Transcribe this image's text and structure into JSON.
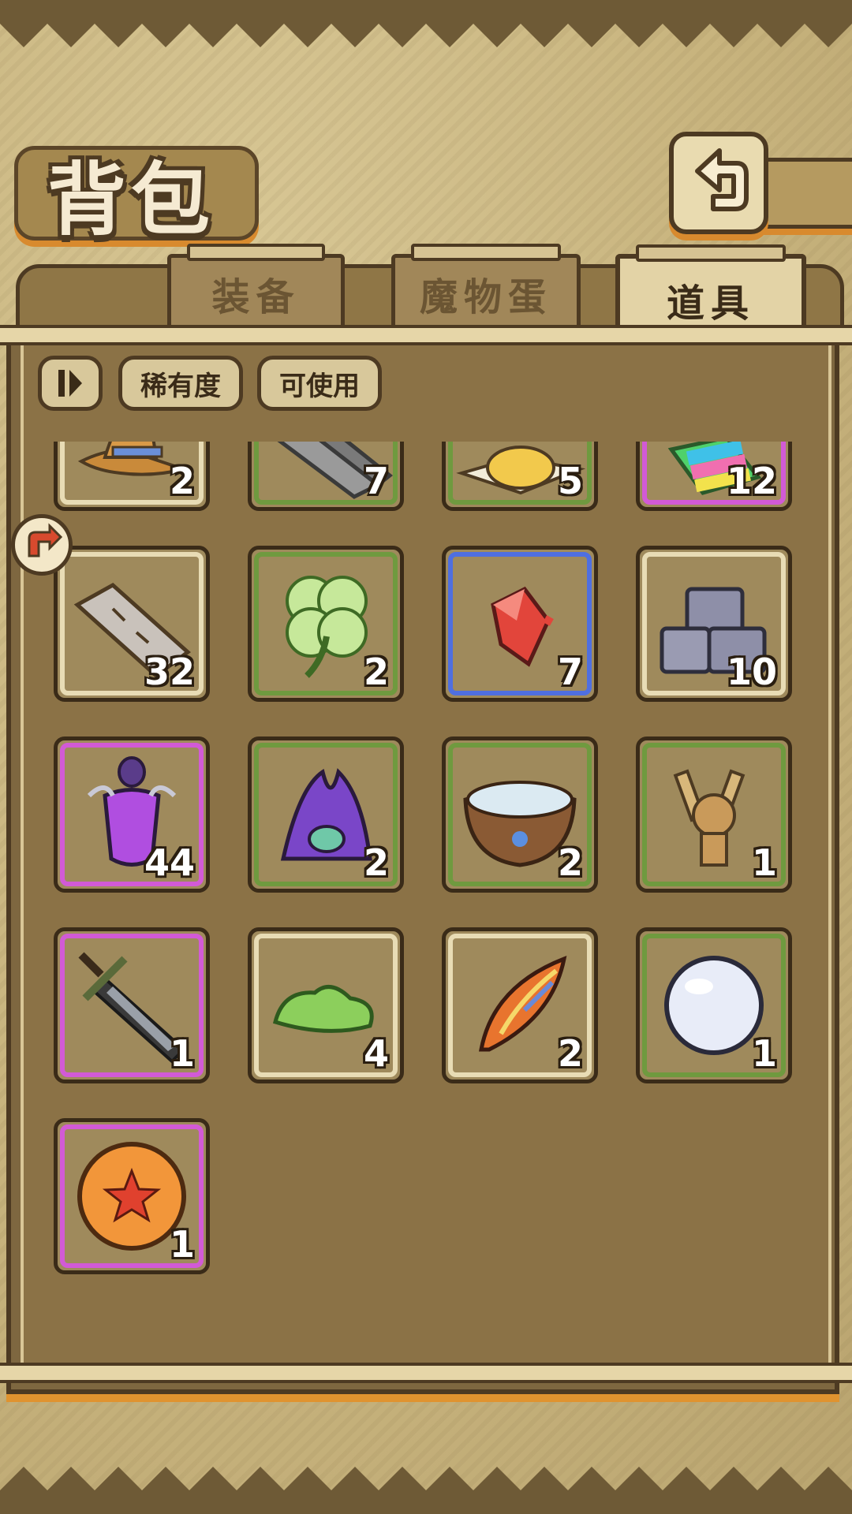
{
  "header": {
    "title": "背包"
  },
  "tabs": [
    {
      "label": "装备",
      "active": false
    },
    {
      "label": "魔物蛋",
      "active": false
    },
    {
      "label": "道具",
      "active": true
    }
  ],
  "filters": {
    "sort_icon": "sort-toggle-icon",
    "rarity_label": "稀有度",
    "usable_label": "可使用"
  },
  "items": [
    {
      "name": "wizard-hat",
      "qty": "2",
      "rarity": "white"
    },
    {
      "name": "iron-bar",
      "qty": "7",
      "rarity": "green"
    },
    {
      "name": "golden-powder",
      "qty": "5",
      "rarity": "green"
    },
    {
      "name": "rainbow-block",
      "qty": "12",
      "rarity": "purple"
    },
    {
      "name": "stone-pillar",
      "qty": "32",
      "rarity": "white"
    },
    {
      "name": "four-leaf-clover",
      "qty": "2",
      "rarity": "green"
    },
    {
      "name": "red-crystal",
      "qty": "7",
      "rarity": "blue"
    },
    {
      "name": "stone-bricks",
      "qty": "10",
      "rarity": "white"
    },
    {
      "name": "purple-potion-vase",
      "qty": "44",
      "rarity": "purple"
    },
    {
      "name": "purple-tentacle-monster",
      "qty": "2",
      "rarity": "green"
    },
    {
      "name": "water-bowl",
      "qty": "2",
      "rarity": "green"
    },
    {
      "name": "voodoo-doll",
      "qty": "1",
      "rarity": "green"
    },
    {
      "name": "dark-sword",
      "qty": "1",
      "rarity": "purple"
    },
    {
      "name": "green-slime",
      "qty": "4",
      "rarity": "white"
    },
    {
      "name": "fire-feather",
      "qty": "2",
      "rarity": "white"
    },
    {
      "name": "white-pearl",
      "qty": "1",
      "rarity": "green"
    },
    {
      "name": "star-orb",
      "qty": "1",
      "rarity": "purple"
    }
  ],
  "colors": {
    "white": "#e8dcb5",
    "green": "#6f9a3f",
    "purple": "#d25ad6",
    "blue": "#4f6fe0",
    "accent": "#e0932f"
  }
}
